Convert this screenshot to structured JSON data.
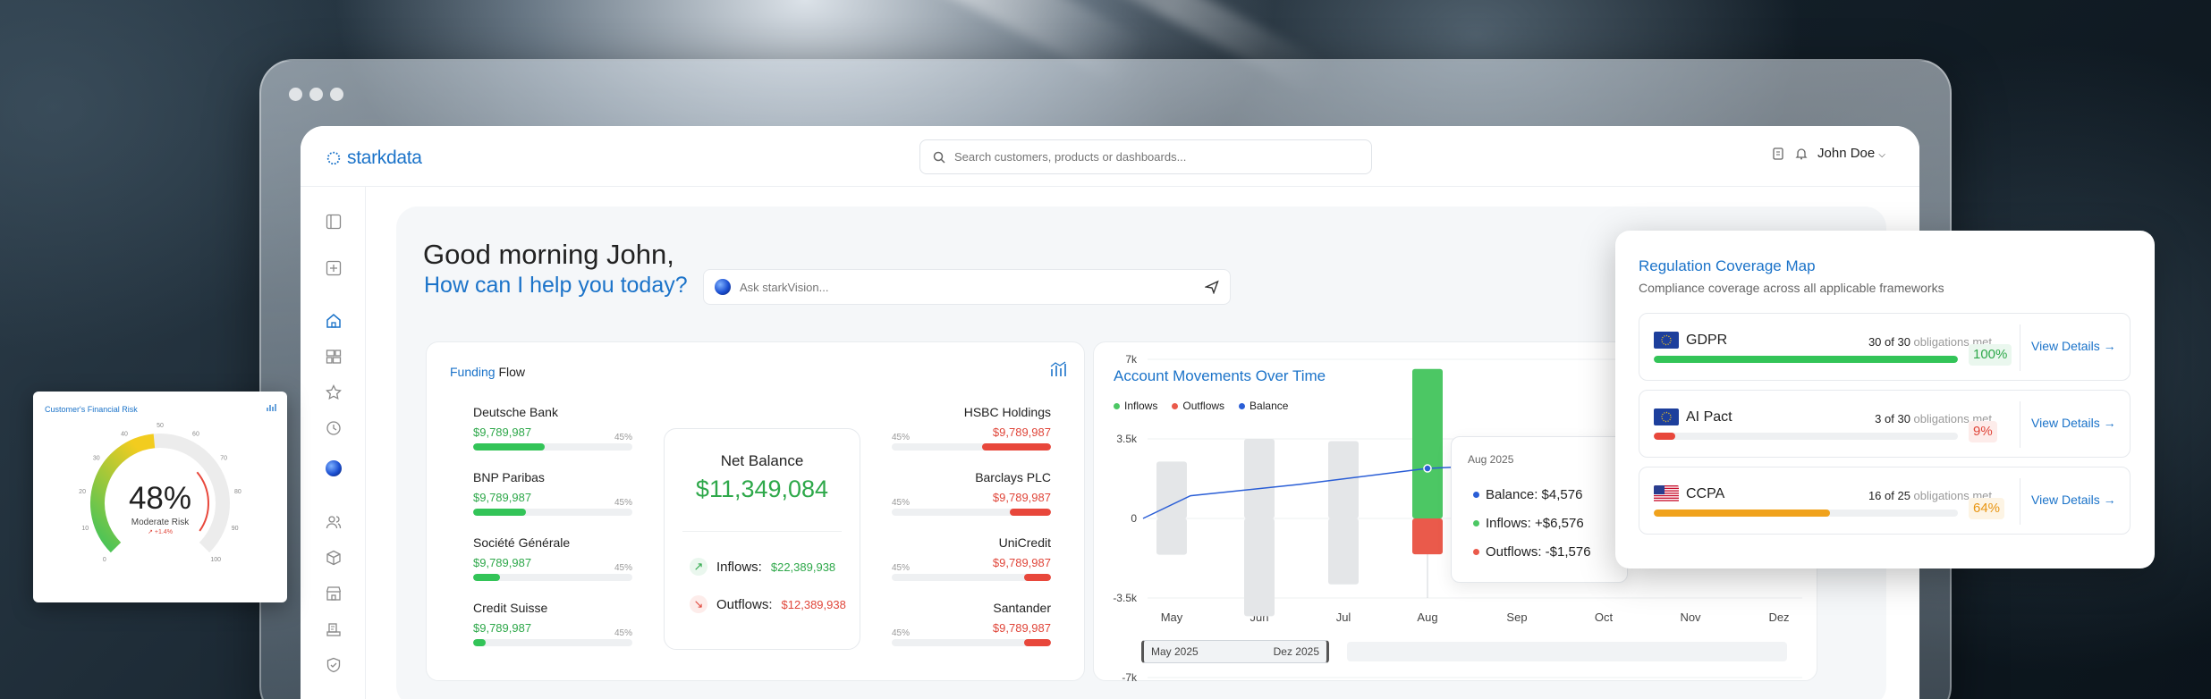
{
  "app": {
    "logo": "starkdata",
    "search_placeholder": "Search customers, products or dashboards...",
    "user_name": "John Doe"
  },
  "greeting": {
    "line1": "Good morning John,",
    "line2": "How can I help you today?",
    "ask_placeholder": "Ask starkVision..."
  },
  "funding_flow": {
    "title_part1": "Funding",
    "title_part2": " Flow",
    "left_banks": [
      {
        "name": "Deutsche Bank",
        "value": "$9,789,987",
        "pct": "45%",
        "fill": 0.45
      },
      {
        "name": "BNP Paribas",
        "value": "$9,789,987",
        "pct": "45%",
        "fill": 0.33
      },
      {
        "name": "Société Générale",
        "value": "$9,789,987",
        "pct": "45%",
        "fill": 0.17
      },
      {
        "name": "Credit Suisse",
        "value": "$9,789,987",
        "pct": "45%",
        "fill": 0.08
      }
    ],
    "right_banks": [
      {
        "name": "HSBC Holdings",
        "value": "$9,789,987",
        "pct": "45%",
        "fill": 0.43
      },
      {
        "name": "Barclays PLC",
        "value": "$9,789,987",
        "pct": "45%",
        "fill": 0.26
      },
      {
        "name": "UniCredit",
        "value": "$9,789,987",
        "pct": "45%",
        "fill": 0.17
      },
      {
        "name": "Santander",
        "value": "$9,789,987",
        "pct": "45%",
        "fill": 0.17
      }
    ],
    "net_balance_label": "Net Balance",
    "net_balance": "$11,349,084",
    "inflows_label": "Inflows:",
    "inflows": "$22,389,938",
    "outflows_label": "Outflows:",
    "outflows": "$12,389,938"
  },
  "account_movements": {
    "title": "Account Movements Over Time",
    "legend": [
      "Inflows",
      "Outflows",
      "Balance"
    ],
    "tooltip": {
      "header": "Aug 2025",
      "balance": "Balance: $4,576",
      "inflows": "Inflows: +$6,576",
      "outflows": "Outflows: -$1,576"
    },
    "range_start": "May 2025",
    "range_end": "Dez 2025"
  },
  "chart_data": {
    "type": "bar",
    "categories": [
      "May",
      "Jun",
      "Jul",
      "Aug",
      "Sep",
      "Oct",
      "Nov",
      "Dez"
    ],
    "y_ticks": [
      "7k",
      "3.5k",
      "0",
      "-3.5k",
      "-7k"
    ],
    "ylim": [
      -7000,
      7000
    ],
    "series": [
      {
        "name": "Inflows",
        "values": [
          2500,
          3500,
          3400,
          6576,
          null,
          null,
          null,
          null
        ]
      },
      {
        "name": "Outflows",
        "values": [
          -1600,
          -4300,
          -2900,
          -1576,
          null,
          null,
          null,
          null
        ]
      },
      {
        "name": "Balance",
        "values": [
          0,
          1000,
          1500,
          2200,
          2300,
          2200,
          null,
          null
        ]
      }
    ],
    "colors": {
      "inflows": "#4cc764",
      "outflows": "#ea5a4b",
      "balance": "#2a5ed6",
      "inactive": "#e4e6e8"
    },
    "highlight": "Aug"
  },
  "regulation": {
    "title_part1": "Regulation ",
    "title_part2": "Coverage Map",
    "subtitle": "Compliance coverage across all applicable frameworks",
    "view_label": "View Details →",
    "frameworks": [
      {
        "name": "GDPR",
        "met": "30 of 30",
        "met_label": " obligations met",
        "pct": "100%",
        "fill": 1.0,
        "color": "#33c458",
        "flag": "eu"
      },
      {
        "name": "AI Pact",
        "met": "3 of 30",
        "met_label": " obligations met",
        "pct": "9%",
        "fill": 0.07,
        "color": "#e8473b",
        "flag": "eu"
      },
      {
        "name": "CCPA",
        "met": "16 of 25",
        "met_label": " obligations met",
        "pct": "64%",
        "fill": 0.58,
        "color": "#f0a21c",
        "flag": "us"
      }
    ]
  },
  "risk": {
    "title": "Customer's Financial Risk",
    "value": "48%",
    "label": "Moderate Risk",
    "change": "+1.4%",
    "gauge": 0.48,
    "ticks": [
      "0",
      "10",
      "20",
      "30",
      "40",
      "50",
      "60",
      "70",
      "80",
      "90",
      "100"
    ]
  }
}
